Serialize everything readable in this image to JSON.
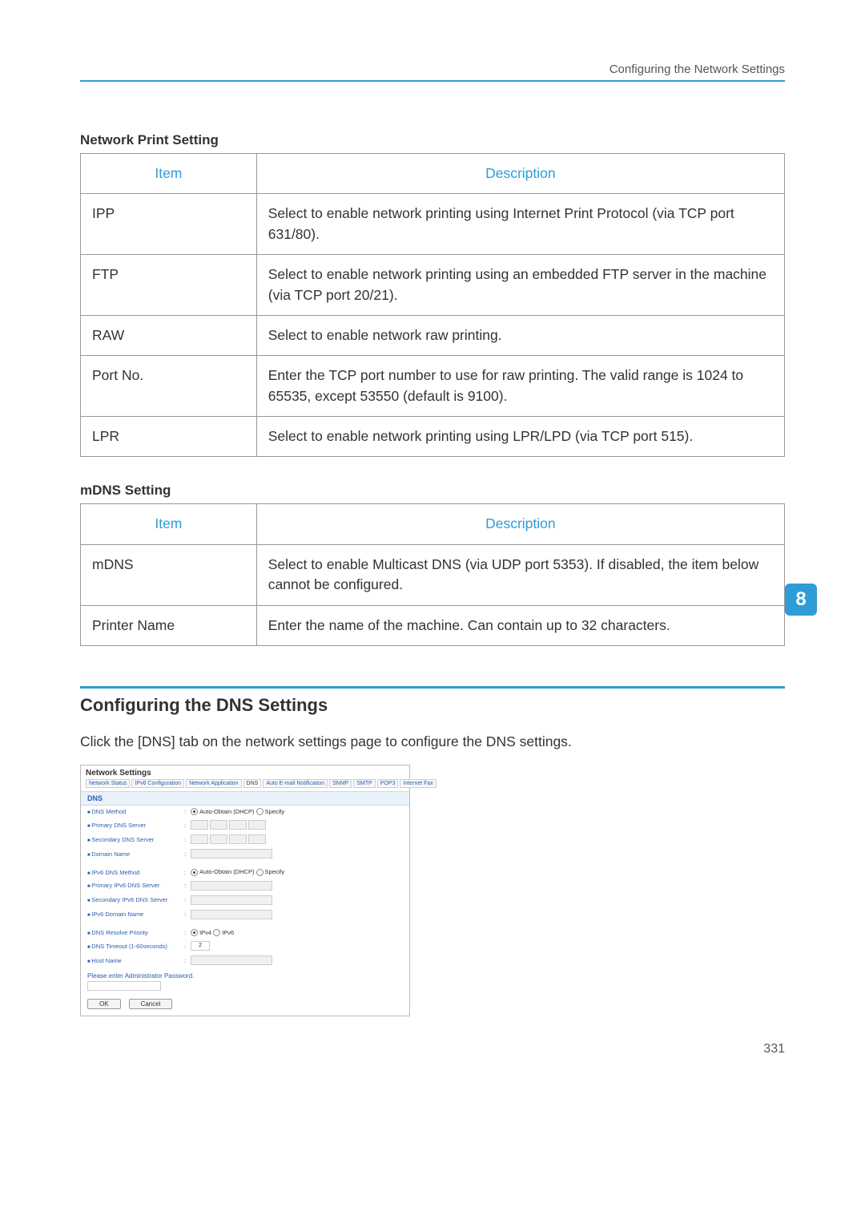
{
  "header": {
    "running_title": "Configuring the Network Settings"
  },
  "chapter_tab": "8",
  "page_number": "331",
  "sections": {
    "network_print": {
      "title": "Network Print Setting",
      "columns": {
        "item": "Item",
        "description": "Description"
      },
      "rows": [
        {
          "item": "IPP",
          "description": "Select to enable network printing using Internet Print Protocol (via TCP port 631/80)."
        },
        {
          "item": "FTP",
          "description": "Select to enable network printing using an embedded FTP server in the machine (via TCP port 20/21)."
        },
        {
          "item": "RAW",
          "description": "Select to enable network raw printing."
        },
        {
          "item": "Port No.",
          "description": "Enter the TCP port number to use for raw printing. The valid range is 1024 to 65535, except 53550 (default is 9100)."
        },
        {
          "item": "LPR",
          "description": "Select to enable network printing using LPR/LPD (via TCP port 515)."
        }
      ]
    },
    "mdns": {
      "title": "mDNS Setting",
      "columns": {
        "item": "Item",
        "description": "Description"
      },
      "rows": [
        {
          "item": "mDNS",
          "description": "Select to enable Multicast DNS (via UDP port 5353). If disabled, the item below cannot be configured."
        },
        {
          "item": "Printer Name",
          "description": "Enter the name of the machine. Can contain up to 32 characters."
        }
      ]
    }
  },
  "dns_heading": "Configuring the DNS Settings",
  "dns_intro": "Click the [DNS] tab on the network settings page to configure the DNS settings.",
  "embedded": {
    "title": "Network Settings",
    "tabs": [
      "Network Status",
      "IPv6 Configuration",
      "Network Application",
      "DNS",
      "Auto E-mail Notification",
      "SNMP",
      "SMTP",
      "POP3",
      "Internet Fax"
    ],
    "active_tab": "DNS",
    "section_head": "DNS",
    "rows": [
      {
        "label": "DNS Method",
        "type": "radio",
        "options": [
          "Auto-Obtain (DHCP)",
          "Specify"
        ],
        "selected": 0
      },
      {
        "label": "Primary DNS Server",
        "type": "ip"
      },
      {
        "label": "Secondary DNS Server",
        "type": "ip"
      },
      {
        "label": "Domain Name",
        "type": "text"
      },
      {
        "label": "IPv6 DNS Method",
        "type": "radio",
        "options": [
          "Auto-Obtain (DHCP)",
          "Specify"
        ],
        "selected": 0
      },
      {
        "label": "Primary IPv6 DNS Server",
        "type": "text"
      },
      {
        "label": "Secondary IPv6 DNS Server",
        "type": "text"
      },
      {
        "label": "IPv6 Domain Name",
        "type": "text"
      },
      {
        "label": "DNS Resolve Priority",
        "type": "radio",
        "options": [
          "IPv4",
          "IPv6"
        ],
        "selected": 0
      },
      {
        "label": "DNS Timeout (1-60seconds)",
        "type": "number",
        "value": "2"
      },
      {
        "label": "Host Name",
        "type": "text"
      }
    ],
    "password_label": "Please enter Administrator Password.",
    "ok": "OK",
    "cancel": "Cancel"
  }
}
